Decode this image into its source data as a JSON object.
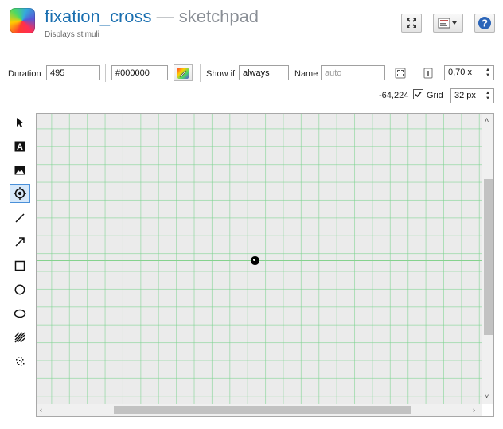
{
  "header": {
    "item_name": "fixation_cross",
    "separator": " — ",
    "item_type": "sketchpad",
    "subtitle": "Displays stimuli"
  },
  "toolbar": {
    "duration_label": "Duration",
    "duration_value": "495",
    "color_value": "#000000",
    "show_if_label": "Show if",
    "show_if_value": "always",
    "name_label": "Name",
    "name_placeholder": "auto",
    "zoom_value": "0,70 x",
    "coordinates": "-64,224",
    "grid_label": "Grid",
    "grid_checked": true,
    "grid_size": "32 px"
  },
  "tools": [
    {
      "name": "pointer-tool",
      "icon": "arrow-pointer-icon"
    },
    {
      "name": "text-tool",
      "icon": "text-icon"
    },
    {
      "name": "image-tool",
      "icon": "image-icon"
    },
    {
      "name": "fixdot-tool",
      "icon": "fixdot-icon",
      "active": true
    },
    {
      "name": "line-tool",
      "icon": "line-icon"
    },
    {
      "name": "arrow-tool",
      "icon": "arrow-icon"
    },
    {
      "name": "rectangle-tool",
      "icon": "rectangle-icon"
    },
    {
      "name": "circle-tool",
      "icon": "circle-icon"
    },
    {
      "name": "ellipse-tool",
      "icon": "ellipse-icon"
    },
    {
      "name": "gabor-tool",
      "icon": "gabor-icon"
    },
    {
      "name": "noise-patch-tool",
      "icon": "noise-icon"
    }
  ],
  "colors": {
    "accent": "#1a6fb0",
    "annotation_arrow": "#f21a1a",
    "grid_line": "#86d28e",
    "canvas_bg": "#ebebeb"
  }
}
